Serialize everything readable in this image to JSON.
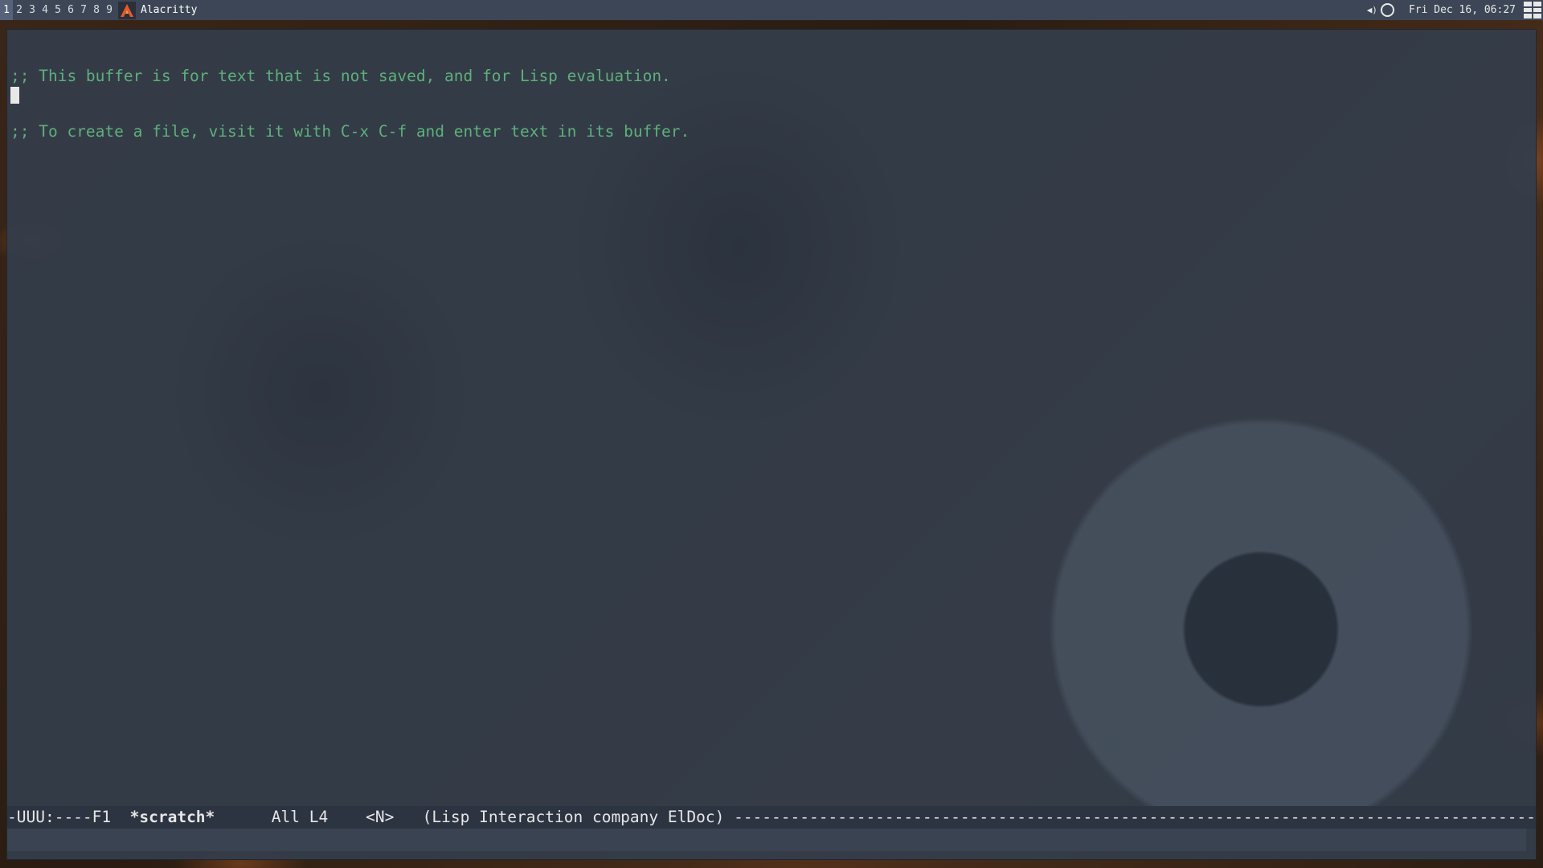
{
  "topbar": {
    "tags": [
      "1",
      "2",
      "3",
      "4",
      "5",
      "6",
      "7",
      "8",
      "9"
    ],
    "active_tag": "1",
    "window_title": "Alacritty",
    "datetime": "Fri Dec 16, 06:27"
  },
  "emacs": {
    "buffer_lines": [
      ";; This buffer is for text that is not saved, and for Lisp evaluation.",
      ";; To create a file, visit it with C-x C-f and enter text in its buffer."
    ],
    "modeline": {
      "status": "-UUU:----F1",
      "buffer_name": "*scratch*",
      "position": "All L4",
      "evil_state": "<N>",
      "modes": "(Lisp Interaction company ElDoc)",
      "fill": "-----------------------------------------------------------------------------------------------------"
    },
    "minibuffer": ""
  },
  "colors": {
    "comment": "#5eb07a",
    "emacs_bg": "#343d4b",
    "topbar_bg": "#3d4656"
  },
  "icons": {
    "app_icon": "alacritty-icon",
    "volume": "volume-icon",
    "status_circle": "circle-icon",
    "layout": "layout-grid-icon"
  }
}
